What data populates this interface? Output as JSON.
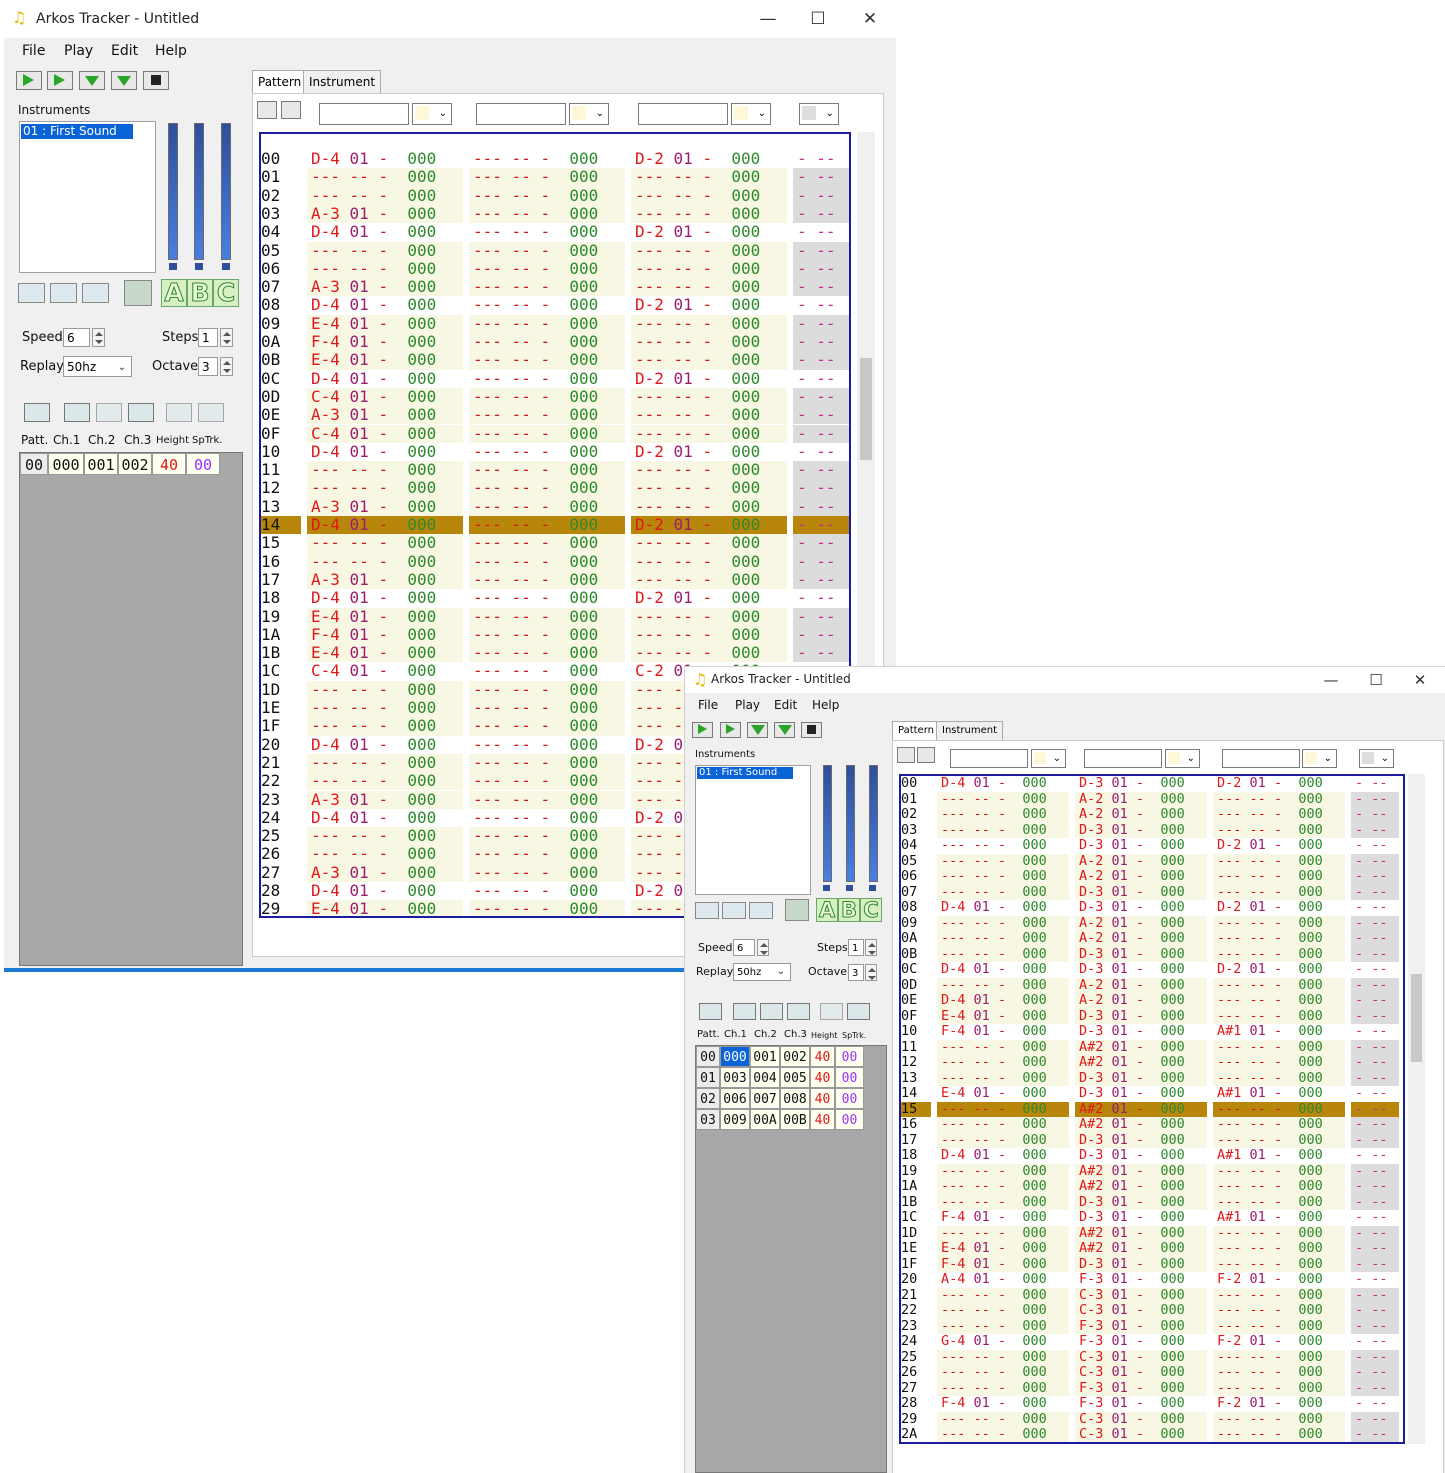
{
  "colors": {
    "accent": "#1f7ad6",
    "cursor_row": "#b8860b",
    "note": "#e01818",
    "instrument": "#9a1d70",
    "effect": "#2c8a2c",
    "height": "#e01818",
    "special": "#9b30ff",
    "frame": "#1a1aa0"
  },
  "windows": [
    {
      "title": "Arkos Tracker - Untitled",
      "menu": [
        "File",
        "Play",
        "Edit",
        "Help"
      ],
      "tabs": [
        "Pattern",
        "Instrument"
      ],
      "instruments_label": "Instruments",
      "instrument_selected": "01 : First Sound",
      "speed_label": "Speed",
      "speed": "6",
      "steps_label": "Steps",
      "steps": "1",
      "replay_label": "Replay",
      "replay": "50hz",
      "octave_label": "Octave",
      "octave": "3",
      "list_headers": [
        "Patt.",
        "Ch.1",
        "Ch.2",
        "Ch.3",
        "Height",
        "SpTrk."
      ],
      "patterns": [
        [
          "00",
          "000",
          "001",
          "002",
          "40",
          "00"
        ]
      ],
      "selected_pattern_cell": -1,
      "cursor_line": "14",
      "tracks": [
        [
          "00 D-4 01 -  000 --- -- -  000 D-2 01 -  000 - --",
          "01 --- -- -  000 --- -- -  000 --- -- -  000 - --",
          "02 --- -- -  000 --- -- -  000 --- -- -  000 - --",
          "03 A-3 01 -  000 --- -- -  000 --- -- -  000 - --",
          "04 D-4 01 -  000 --- -- -  000 D-2 01 -  000 - --",
          "05 --- -- -  000 --- -- -  000 --- -- -  000 - --",
          "06 --- -- -  000 --- -- -  000 --- -- -  000 - --",
          "07 A-3 01 -  000 --- -- -  000 --- -- -  000 - --",
          "08 D-4 01 -  000 --- -- -  000 D-2 01 -  000 - --",
          "09 E-4 01 -  000 --- -- -  000 --- -- -  000 - --",
          "0A F-4 01 -  000 --- -- -  000 --- -- -  000 - --",
          "0B E-4 01 -  000 --- -- -  000 --- -- -  000 - --",
          "0C D-4 01 -  000 --- -- -  000 D-2 01 -  000 - --",
          "0D C-4 01 -  000 --- -- -  000 --- -- -  000 - --",
          "0E A-3 01 -  000 --- -- -  000 --- -- -  000 - --",
          "0F C-4 01 -  000 --- -- -  000 --- -- -  000 - --",
          "10 D-4 01 -  000 --- -- -  000 D-2 01 -  000 - --",
          "11 --- -- -  000 --- -- -  000 --- -- -  000 - --",
          "12 --- -- -  000 --- -- -  000 --- -- -  000 - --",
          "13 A-3 01 -  000 --- -- -  000 --- -- -  000 - --",
          "14 D-4 01 -  000 --- -- -  000 D-2 01 -  000 - --",
          "15 --- -- -  000 --- -- -  000 --- -- -  000 - --",
          "16 --- -- -  000 --- -- -  000 --- -- -  000 - --",
          "17 A-3 01 -  000 --- -- -  000 --- -- -  000 - --",
          "18 D-4 01 -  000 --- -- -  000 D-2 01 -  000 - --",
          "19 E-4 01 -  000 --- -- -  000 --- -- -  000 - --",
          "1A F-4 01 -  000 --- -- -  000 --- -- -  000 - --",
          "1B E-4 01 -  000 --- -- -  000 --- -- -  000 - --",
          "1C C-4 01 -  000 --- -- -  000 C-2 01 -  000 - --",
          "1D --- -- -  000 --- -- -  000 --- -- -  000 - --",
          "1E --- -- -  000 --- -- -  000 --- -- -  000 - --",
          "1F --- -- -  000 --- -- -  000 --- -- -  000 - --",
          "20 D-4 01 -  000 --- -- -  000 D-2 01 -  000 - --",
          "21 --- -- -  000 --- -- -  000 --- -- -  000 - --",
          "22 --- -- -  000 --- -- -  000 --- -- -  000 - --",
          "23 A-3 01 -  000 --- -- -  000 --- -- -  000 - --",
          "24 D-4 01 -  000 --- -- -  000 D-2 01 -  000 - --",
          "25 --- -- -  000 --- -- -  000 --- -- -  000 - --",
          "26 --- -- -  000 --- -- -  000 --- -- -  000 - --",
          "27 A-3 01 -  000 --- -- -  000 --- -- -  000 - --",
          "28 D-4 01 -  000 --- -- -  000 D-2 01 -  000 - --",
          "29 E-4 01 -  000 --- -- -  000 --- -- -  000 - --"
        ]
      ]
    },
    {
      "title": "Arkos Tracker - Untitled",
      "menu": [
        "File",
        "Play",
        "Edit",
        "Help"
      ],
      "tabs": [
        "Pattern",
        "Instrument"
      ],
      "instruments_label": "Instruments",
      "instrument_selected": "01 : First Sound",
      "speed_label": "Speed",
      "speed": "6",
      "steps_label": "Steps",
      "steps": "1",
      "replay_label": "Replay",
      "replay": "50hz",
      "octave_label": "Octave",
      "octave": "3",
      "list_headers": [
        "Patt.",
        "Ch.1",
        "Ch.2",
        "Ch.3",
        "Height",
        "SpTrk."
      ],
      "patterns": [
        [
          "00",
          "000",
          "001",
          "002",
          "40",
          "00"
        ],
        [
          "01",
          "003",
          "004",
          "005",
          "40",
          "00"
        ],
        [
          "02",
          "006",
          "007",
          "008",
          "40",
          "00"
        ],
        [
          "03",
          "009",
          "00A",
          "00B",
          "40",
          "00"
        ]
      ],
      "selected_pattern_cell": 1,
      "cursor_line": "15",
      "tracks": [
        [
          "00 D-4 01 -  000 D-3 01 -  000 D-2 01 -  000 - --",
          "01 --- -- -  000 A-2 01 -  000 --- -- -  000 - --",
          "02 --- -- -  000 A-2 01 -  000 --- -- -  000 - --",
          "03 --- -- -  000 D-3 01 -  000 --- -- -  000 - --",
          "04 --- -- -  000 D-3 01 -  000 D-2 01 -  000 - --",
          "05 --- -- -  000 A-2 01 -  000 --- -- -  000 - --",
          "06 --- -- -  000 A-2 01 -  000 --- -- -  000 - --",
          "07 --- -- -  000 D-3 01 -  000 --- -- -  000 - --",
          "08 D-4 01 -  000 D-3 01 -  000 D-2 01 -  000 - --",
          "09 --- -- -  000 A-2 01 -  000 --- -- -  000 - --",
          "0A --- -- -  000 A-2 01 -  000 --- -- -  000 - --",
          "0B --- -- -  000 D-3 01 -  000 --- -- -  000 - --",
          "0C D-4 01 -  000 D-3 01 -  000 D-2 01 -  000 - --",
          "0D --- -- -  000 A-2 01 -  000 --- -- -  000 - --",
          "0E D-4 01 -  000 A-2 01 -  000 --- -- -  000 - --",
          "0F E-4 01 -  000 D-3 01 -  000 --- -- -  000 - --",
          "10 F-4 01 -  000 D-3 01 -  000 A#1 01 -  000 - --",
          "11 --- -- -  000 A#2 01 -  000 --- -- -  000 - --",
          "12 --- -- -  000 A#2 01 -  000 --- -- -  000 - --",
          "13 --- -- -  000 D-3 01 -  000 --- -- -  000 - --",
          "14 E-4 01 -  000 D-3 01 -  000 A#1 01 -  000 - --",
          "15 --- -- -  000 A#2 01 -  000 --- -- -  000 - --",
          "16 --- -- -  000 A#2 01 -  000 --- -- -  000 - --",
          "17 --- -- -  000 D-3 01 -  000 --- -- -  000 - --",
          "18 D-4 01 -  000 D-3 01 -  000 A#1 01 -  000 - --",
          "19 --- -- -  000 A#2 01 -  000 --- -- -  000 - --",
          "1A --- -- -  000 A#2 01 -  000 --- -- -  000 - --",
          "1B --- -- -  000 D-3 01 -  000 --- -- -  000 - --",
          "1C F-4 01 -  000 D-3 01 -  000 A#1 01 -  000 - --",
          "1D --- -- -  000 A#2 01 -  000 --- -- -  000 - --",
          "1E E-4 01 -  000 A#2 01 -  000 --- -- -  000 - --",
          "1F F-4 01 -  000 D-3 01 -  000 --- -- -  000 - --",
          "20 A-4 01 -  000 F-3 01 -  000 F-2 01 -  000 - --",
          "21 --- -- -  000 C-3 01 -  000 --- -- -  000 - --",
          "22 --- -- -  000 C-3 01 -  000 --- -- -  000 - --",
          "23 --- -- -  000 F-3 01 -  000 --- -- -  000 - --",
          "24 G-4 01 -  000 F-3 01 -  000 F-2 01 -  000 - --",
          "25 --- -- -  000 C-3 01 -  000 --- -- -  000 - --",
          "26 --- -- -  000 C-3 01 -  000 --- -- -  000 - --",
          "27 --- -- -  000 F-3 01 -  000 --- -- -  000 - --",
          "28 F-4 01 -  000 F-3 01 -  000 F-2 01 -  000 - --",
          "29 --- -- -  000 C-3 01 -  000 --- -- -  000 - --",
          "2A --- -- -  000 C-3 01 -  000 --- -- -  000 - --"
        ]
      ]
    }
  ]
}
